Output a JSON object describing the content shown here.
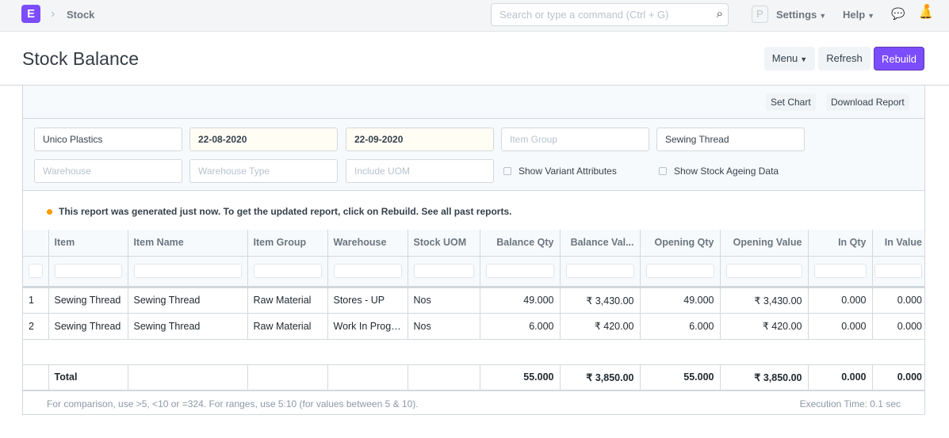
{
  "nav": {
    "logo": "E",
    "breadcrumb": "Stock",
    "search_placeholder": "Search or type a command (Ctrl + G)",
    "avatar": "P",
    "settings": "Settings",
    "help": "Help"
  },
  "page": {
    "title": "Stock Balance",
    "menu": "Menu",
    "refresh": "Refresh",
    "rebuild": "Rebuild"
  },
  "toolbar": {
    "set_chart": "Set Chart",
    "download": "Download Report"
  },
  "filters": {
    "company": "Unico Plastics",
    "from_date": "22-08-2020",
    "to_date": "22-09-2020",
    "item_group": "Item Group",
    "item": "Sewing Thread",
    "warehouse": "Warehouse",
    "warehouse_type": "Warehouse Type",
    "include_uom": "Include UOM",
    "show_variant": "Show Variant Attributes",
    "show_ageing": "Show Stock Ageing Data"
  },
  "message": {
    "text": "This report was generated just now. To get the updated report, click on Rebuild.",
    "link": "See all past reports."
  },
  "table": {
    "columns": [
      "Item",
      "Item Name",
      "Item Group",
      "Warehouse",
      "Stock UOM",
      "Balance Qty",
      "Balance Val...",
      "Opening Qty",
      "Opening Value",
      "In Qty",
      "In Value"
    ],
    "rows": [
      [
        "1",
        "Sewing Thread",
        "Sewing Thread",
        "Raw Material",
        "Stores - UP",
        "Nos",
        "49.000",
        "₹ 3,430.00",
        "49.000",
        "₹ 3,430.00",
        "0.000",
        "0.000"
      ],
      [
        "2",
        "Sewing Thread",
        "Sewing Thread",
        "Raw Material",
        "Work In Progress",
        "Nos",
        "6.000",
        "₹ 420.00",
        "6.000",
        "₹ 420.00",
        "0.000",
        "0.000"
      ]
    ],
    "total": [
      "",
      "Total",
      "",
      "",
      "",
      "",
      "55.000",
      "₹ 3,850.00",
      "55.000",
      "₹ 3,850.00",
      "0.000",
      "0.000"
    ]
  },
  "footer": {
    "hint": "For comparison, use >5, <10 or =324. For ranges, use 5:10 (for values between 5 & 10).",
    "execution": "Execution Time: 0.1 sec"
  },
  "colors": {
    "accent": "#7c4dff",
    "indicator": "#ff9800"
  }
}
